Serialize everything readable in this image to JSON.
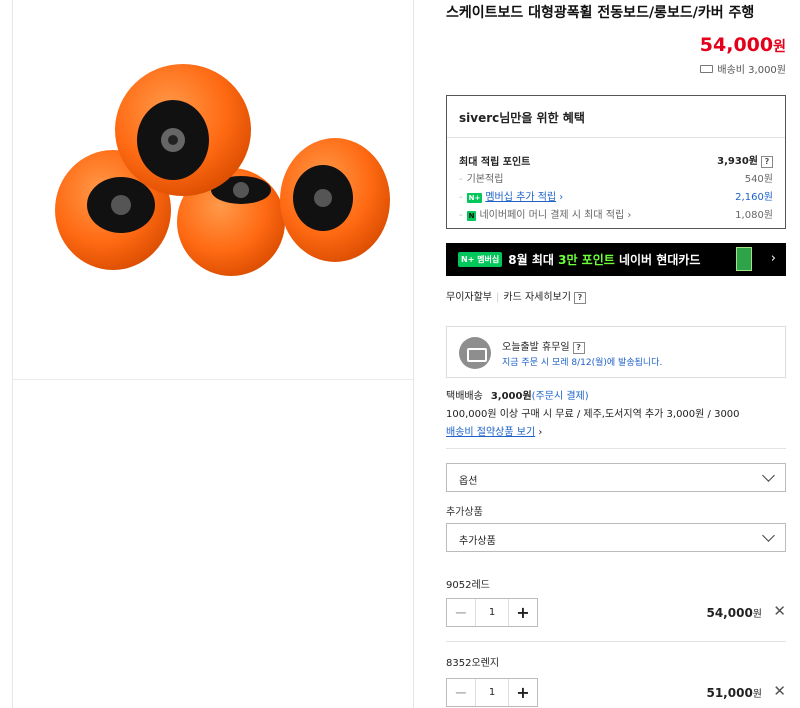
{
  "product": {
    "title": "스케이트보드 대형광폭휠 전동보드/롱보드/카버 주행",
    "price": "54,000",
    "price_unit": "원",
    "shipping_note": "배송비 3,000원"
  },
  "benefit": {
    "header": "siverc님만을 위한 혜택",
    "max_points_label": "최대 적립 포인트",
    "max_points_value": "3,930원",
    "rows": [
      {
        "label": "기본적립",
        "value": "540원"
      },
      {
        "label": "멤버십 추가 적립",
        "value": "2,160원"
      },
      {
        "label": "네이버페이 머니 결제 시 최대 적립",
        "value": "1,080원"
      }
    ]
  },
  "banner": {
    "tag": "N+ 멤버십",
    "text_a": "8월 최대 ",
    "text_hl": "3만 포인트",
    "text_b": " 네이버 현대카드"
  },
  "card_links": {
    "interest_free": "무이자할부",
    "card_detail": "카드 자세히보기"
  },
  "today": {
    "title": "오늘출발 휴무일",
    "note": "지금 주문 시 모레 8/12(월)에 발송됩니다."
  },
  "delivery": {
    "label": "택배배송",
    "fee": "3,000원",
    "fee_note": "(주문시 결제)",
    "condition": "100,000원 이상 구매 시 무료 / 제주,도서지역 추가 3,000원 / 3000",
    "save_link": "배송비 절약상품 보기"
  },
  "options": {
    "option_placeholder": "옵션",
    "addon_label": "추가상품",
    "addon_placeholder": "추가상품"
  },
  "items": [
    {
      "name": "9052레드",
      "qty": "1",
      "amount": "54,000",
      "unit": "원"
    },
    {
      "name": "8352오렌지",
      "qty": "1",
      "amount": "51,000",
      "unit": "원"
    }
  ],
  "colors": {
    "price": "#e4001b",
    "naver_green": "#03c75a",
    "link_blue": "#1e62c9",
    "wheel_orange": "#ff6a13"
  }
}
